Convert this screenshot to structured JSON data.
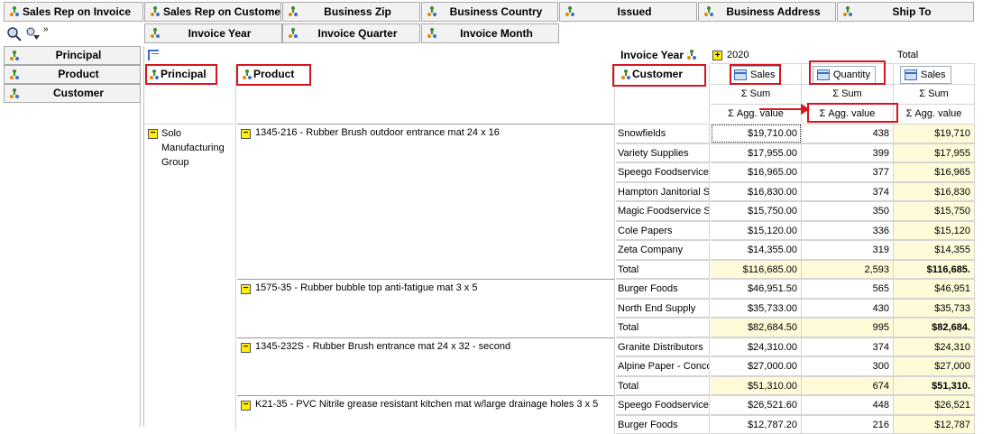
{
  "filter_fields": [
    {
      "label": "Sales Rep on Invoice"
    },
    {
      "label": "Sales Rep on Customer"
    },
    {
      "label": "Business Zip"
    },
    {
      "label": "Business Country"
    },
    {
      "label": "Issued"
    },
    {
      "label": "Business Address"
    },
    {
      "label": "Ship To"
    }
  ],
  "column_fields": [
    {
      "label": "Invoice Year"
    },
    {
      "label": "Invoice Quarter"
    },
    {
      "label": "Invoice Month"
    }
  ],
  "row_fields_list": [
    {
      "label": "Principal"
    },
    {
      "label": "Product"
    },
    {
      "label": "Customer"
    }
  ],
  "row_headers": {
    "principal": "Principal",
    "product": "Product",
    "customer": "Customer"
  },
  "column_header": {
    "field": "Invoice Year",
    "year": "2020",
    "total": "Total",
    "measures": [
      {
        "label": "Sales",
        "agg": "Σ  Sum",
        "sub": "Σ  Agg. value"
      },
      {
        "label": "Quantity",
        "agg": "Σ  Sum",
        "sub": "Σ  Agg. value"
      },
      {
        "label": "Sales",
        "agg": "Σ  Sum",
        "sub": "Σ  Agg. value"
      }
    ]
  },
  "principal_group": "Solo Manufacturing Group",
  "products": [
    {
      "name": "1345-216 - Rubber Brush outdoor entrance mat 24 x 16",
      "rows": [
        {
          "customer": "Snowfields",
          "sales": "$19,710.00",
          "qty": "438",
          "total": "$19,710"
        },
        {
          "customer": "Variety Supplies",
          "sales": "$17,955.00",
          "qty": "399",
          "total": "$17,955"
        },
        {
          "customer": "Speego Foodservice",
          "sales": "$16,965.00",
          "qty": "377",
          "total": "$16,965"
        },
        {
          "customer": "Hampton Janitorial S",
          "sales": "$16,830.00",
          "qty": "374",
          "total": "$16,830"
        },
        {
          "customer": "Magic Foodservice S",
          "sales": "$15,750.00",
          "qty": "350",
          "total": "$15,750"
        },
        {
          "customer": "Cole Papers",
          "sales": "$15,120.00",
          "qty": "336",
          "total": "$15,120"
        },
        {
          "customer": "Zeta Company",
          "sales": "$14,355.00",
          "qty": "319",
          "total": "$14,355"
        }
      ],
      "total": {
        "label": "Total",
        "sales": "$116,685.00",
        "qty": "2,593",
        "total": "$116,685."
      }
    },
    {
      "name": "1575-35 - Rubber bubble top anti-fatigue mat 3 x 5",
      "rows": [
        {
          "customer": "Burger Foods",
          "sales": "$46,951.50",
          "qty": "565",
          "total": "$46,951"
        },
        {
          "customer": "North End Supply",
          "sales": "$35,733.00",
          "qty": "430",
          "total": "$35,733"
        }
      ],
      "total": {
        "label": "Total",
        "sales": "$82,684.50",
        "qty": "995",
        "total": "$82,684."
      }
    },
    {
      "name": "1345-232S - Rubber Brush entrance mat 24 x 32 - second",
      "rows": [
        {
          "customer": "Granite Distributors",
          "sales": "$24,310.00",
          "qty": "374",
          "total": "$24,310"
        },
        {
          "customer": "Alpine Paper - Conco",
          "sales": "$27,000.00",
          "qty": "300",
          "total": "$27,000"
        }
      ],
      "total": {
        "label": "Total",
        "sales": "$51,310.00",
        "qty": "674",
        "total": "$51,310."
      }
    },
    {
      "name": "K21-35 - PVC Nitrile grease resistant kitchen mat w/large drainage holes 3 x 5",
      "rows": [
        {
          "customer": "Speego Foodservice",
          "sales": "$26,521.60",
          "qty": "448",
          "total": "$26,521"
        },
        {
          "customer": "Burger Foods",
          "sales": "$12,787.20",
          "qty": "216",
          "total": "$12,787"
        }
      ]
    }
  ],
  "colors": {
    "highlight_red": "#d9141e",
    "total_bg": "#fffbd9",
    "minus_yellow": "#ffef00"
  }
}
